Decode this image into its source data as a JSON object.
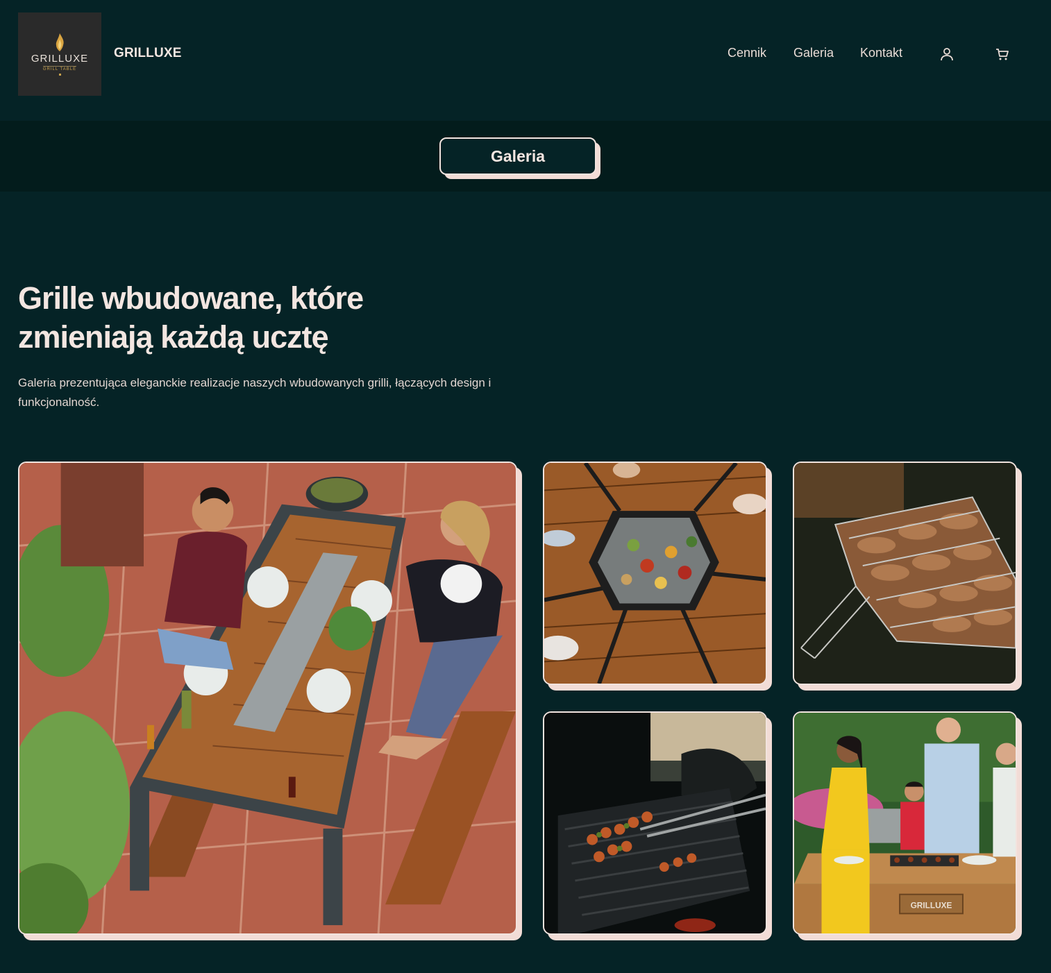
{
  "brand": {
    "logo_word": "GRILLUXE",
    "logo_sub": "GRILL TABLE",
    "name": "GRILLUXE"
  },
  "nav": {
    "items": [
      "Cennik",
      "Galeria",
      "Kontakt"
    ],
    "icons": [
      "user-icon",
      "cart-icon"
    ]
  },
  "band": {
    "button_label": "Galeria"
  },
  "hero": {
    "title": "Grille wbudowane, które zmieniają każdą ucztę",
    "description": "Galeria prezentująca eleganckie realizacje naszych wbudowanych grilli, łączących design i funkcjonalność."
  },
  "gallery": {
    "images": [
      "photo-couple-at-grill-table",
      "photo-hexagonal-grill-table",
      "photo-grill-basket-with-meat",
      "photo-skewers-on-grill",
      "photo-family-at-grilluxe-table"
    ],
    "table_sign": "GRILLUXE"
  },
  "colors": {
    "background": "#052326",
    "band": "#031c1c",
    "accent": "#f2dcd6",
    "text": "#f3e6e1"
  }
}
